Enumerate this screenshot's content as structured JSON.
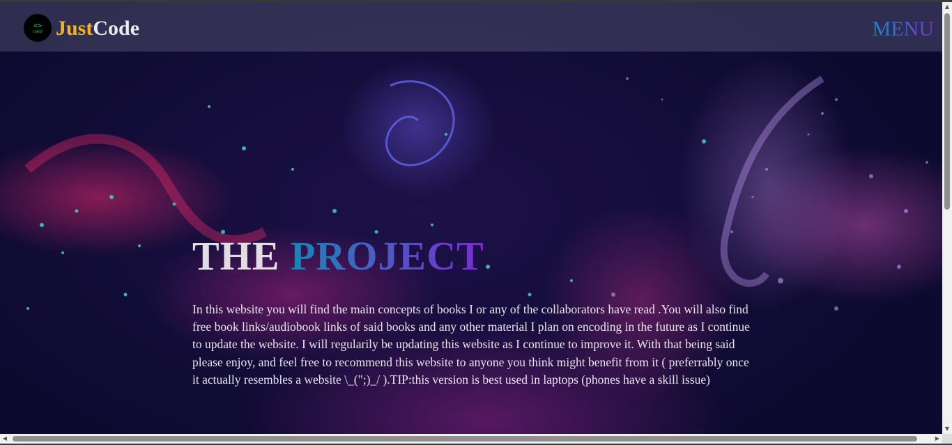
{
  "navbar": {
    "brand_part1": "Just",
    "brand_part2": "Code",
    "logo_glyph": "<>",
    "logo_text": "CONST",
    "menu_label": "MENU"
  },
  "hero": {
    "title_word1": "THE",
    "title_word2": "PROJECT",
    "paragraph": "In this website you will find the main concepts of books I or any of the collaborators have read .You will also find free book links/audiobook links of said books and any other material I plan on encoding in the future as I continue to update the website. I will regularily be updating this website as I continue to improve it. With that being said please enjoy, and feel free to recommend this website to anyone you think might benefit from it ( preferrably once it actually resembles a website \\_(\";)_/ ).TIP:this version is best used in laptops (phones have a skill issue)"
  },
  "colors": {
    "brand_accent": "#f5b31e",
    "menu_gradient_start": "#1a8cc4",
    "menu_gradient_end": "#7a2fd3",
    "logo_icon": "#1fd16a"
  },
  "icons": {
    "logo": "code-brackets-icon",
    "scroll_up": "triangle-up-icon",
    "scroll_down": "triangle-down-icon",
    "scroll_left": "triangle-left-icon",
    "scroll_right": "triangle-right-icon"
  }
}
